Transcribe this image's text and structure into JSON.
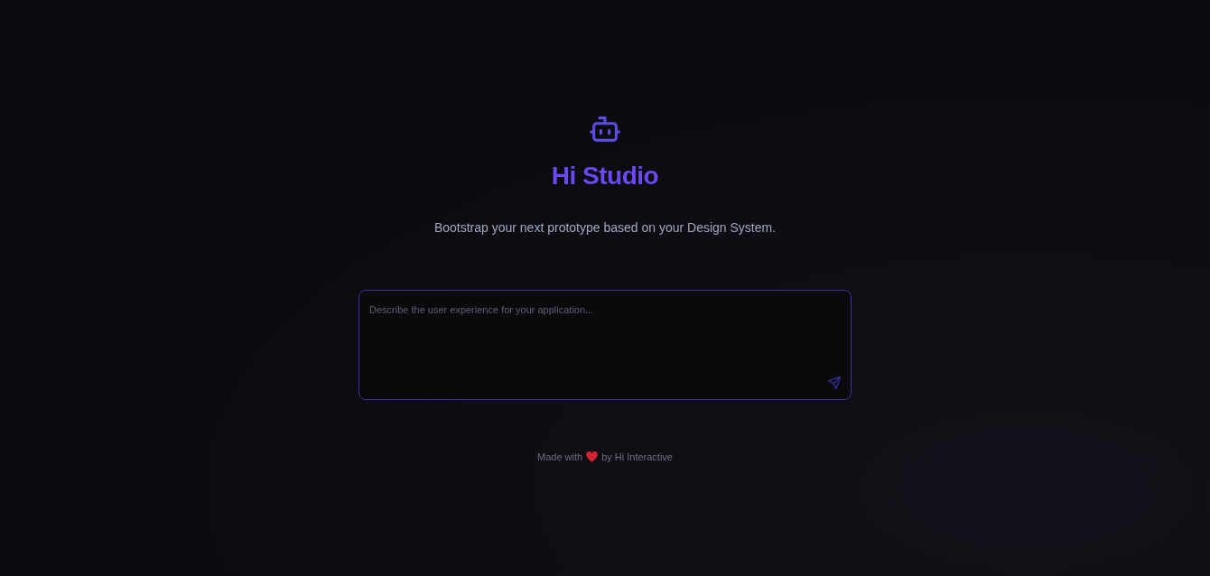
{
  "brand": {
    "title": "Hi Studio"
  },
  "tagline": "Bootstrap your next prototype based on your Design System.",
  "prompt": {
    "placeholder": "Describe the user experience for your application..."
  },
  "footer": {
    "before": "Made with",
    "after": "by Hi Interactive"
  }
}
